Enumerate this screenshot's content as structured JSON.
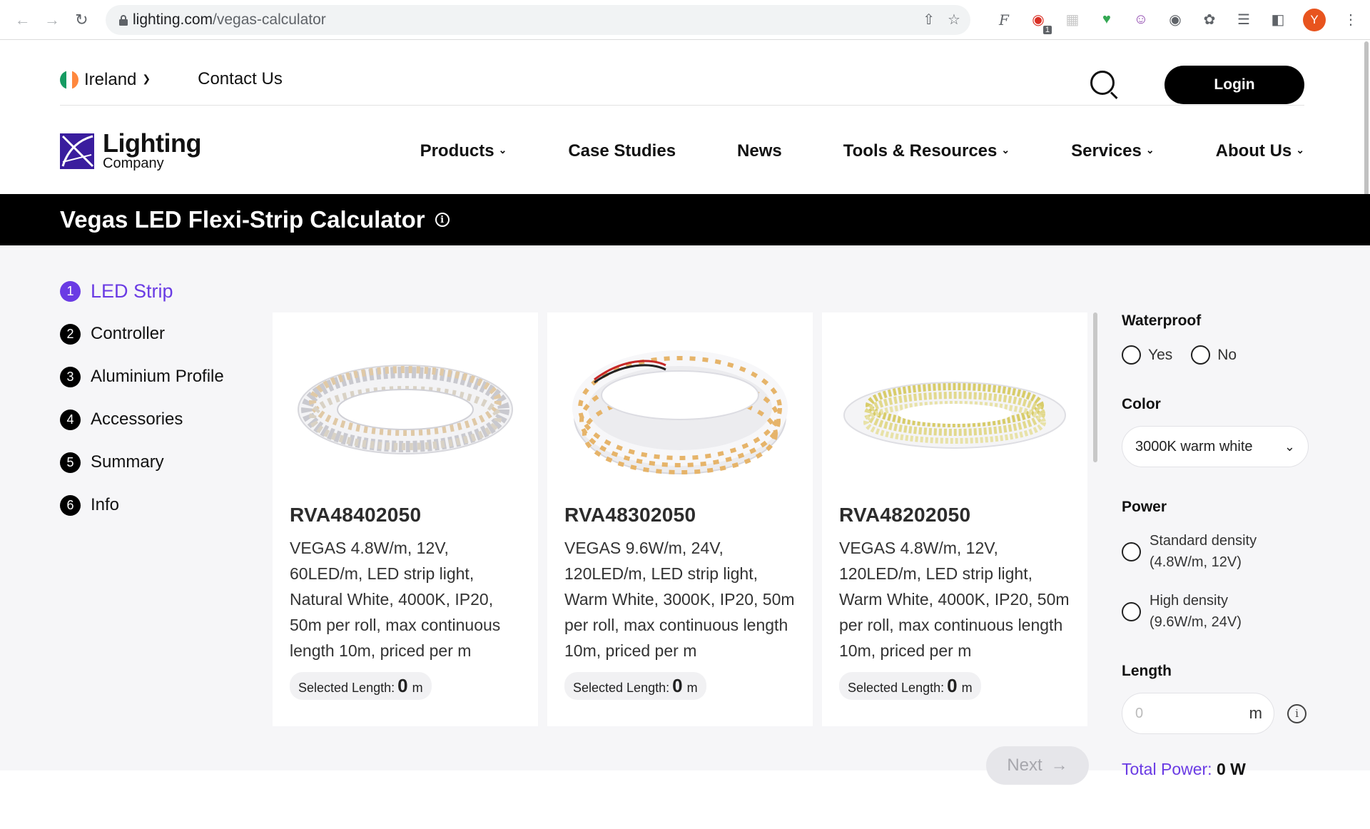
{
  "browser": {
    "url_host": "lighting.com",
    "url_path": "/vegas-calculator",
    "avatar_letter": "Y",
    "extension_badge": "1"
  },
  "topbar": {
    "country": "Ireland",
    "contact": "Contact Us",
    "login": "Login"
  },
  "logo": {
    "line1": "Lighting",
    "line2": "Company"
  },
  "nav": [
    "Products",
    "Case Studies",
    "News",
    "Tools & Resources",
    "Services",
    "About Us"
  ],
  "banner": {
    "title": "Vegas LED Flexi-Strip Calculator"
  },
  "steps": [
    {
      "num": "1",
      "label": "LED Strip"
    },
    {
      "num": "2",
      "label": "Controller"
    },
    {
      "num": "3",
      "label": "Aluminium Profile"
    },
    {
      "num": "4",
      "label": "Accessories"
    },
    {
      "num": "5",
      "label": "Summary"
    },
    {
      "num": "6",
      "label": "Info"
    }
  ],
  "products": [
    {
      "sku": "RVA48402050",
      "desc": "VEGAS 4.8W/m, 12V, 60LED/m, LED strip light, Natural White, 4000K, IP20, 50m per roll, max continuous length 10m, priced per m",
      "sel_label": "Selected Length:",
      "sel_value": "0",
      "sel_unit": "m"
    },
    {
      "sku": "RVA48302050",
      "desc": "VEGAS 9.6W/m, 24V, 120LED/m, LED strip light, Warm White, 3000K, IP20, 50m per roll, max continuous length 10m, priced per m",
      "sel_label": "Selected Length:",
      "sel_value": "0",
      "sel_unit": "m"
    },
    {
      "sku": "RVA48202050",
      "desc": "VEGAS 4.8W/m, 12V, 120LED/m, LED strip light, Warm White, 4000K, IP20, 50m per roll, max continuous length 10m, priced per m",
      "sel_label": "Selected Length:",
      "sel_value": "0",
      "sel_unit": "m"
    }
  ],
  "next": "Next",
  "filters": {
    "waterproof_title": "Waterproof",
    "yes": "Yes",
    "no": "No",
    "color_title": "Color",
    "color_value": "3000K warm white",
    "power_title": "Power",
    "power_std_1": "Standard density",
    "power_std_2": "(4.8W/m, 12V)",
    "power_high_1": "High density",
    "power_high_2": "(9.6W/m, 24V)",
    "length_title": "Length",
    "length_placeholder": "0",
    "length_unit": "m",
    "total_label": "Total Power:",
    "total_value": "0 W"
  },
  "colors": {
    "accent": "#6a3be4",
    "banner": "#000000"
  }
}
